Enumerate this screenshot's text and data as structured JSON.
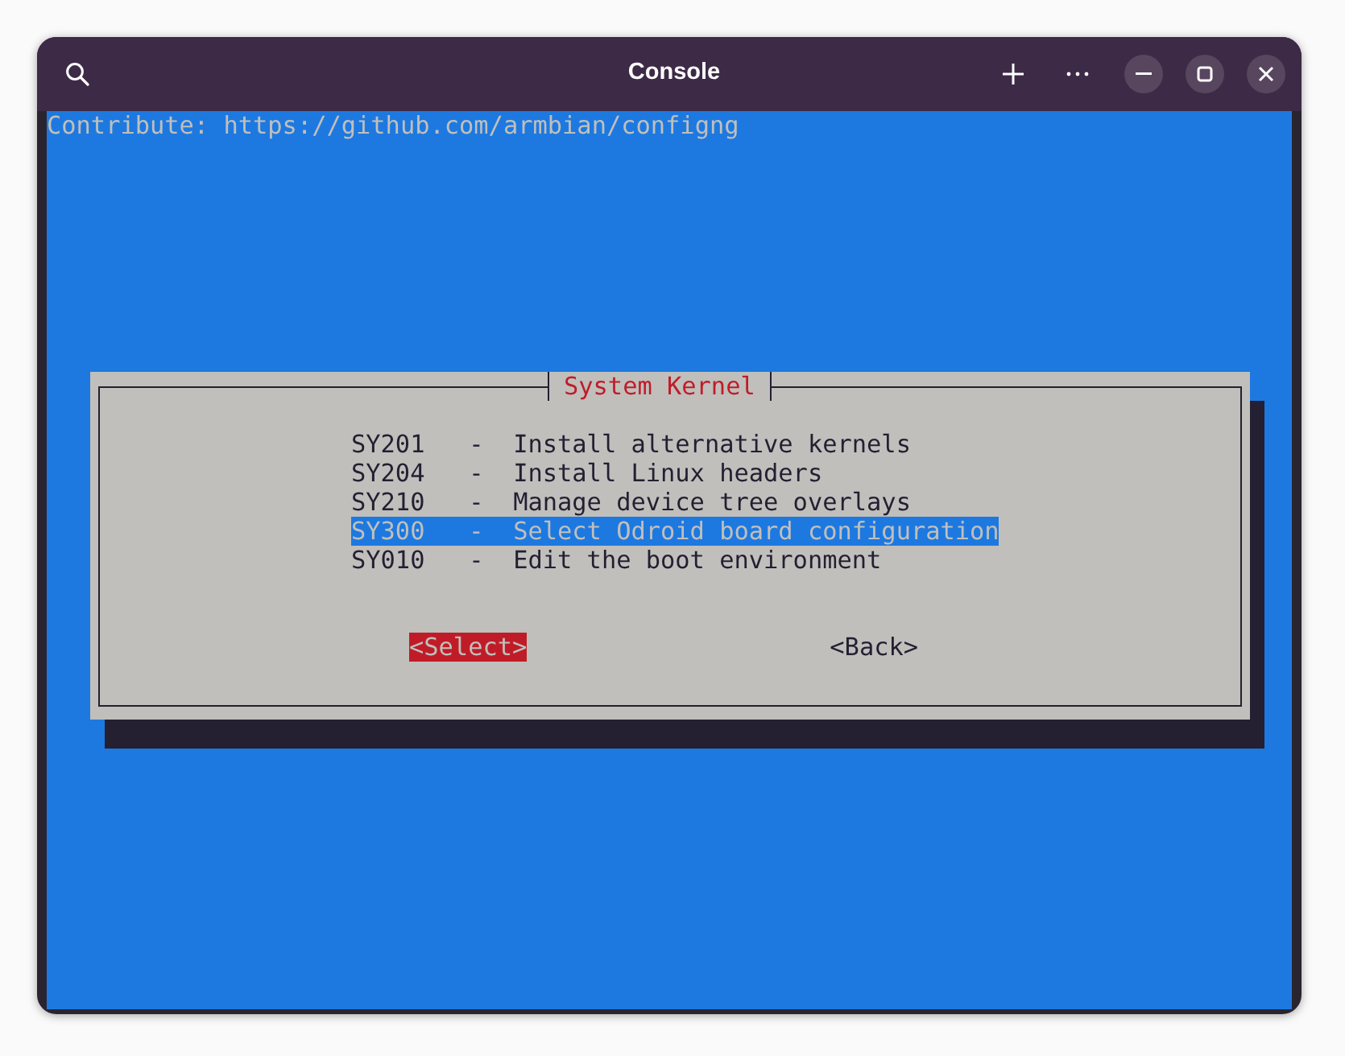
{
  "window": {
    "title": "Console"
  },
  "terminal": {
    "lines": [
      "Contribute: https://github.com/armbian/configng"
    ]
  },
  "dialog": {
    "title": "System Kernel",
    "items": [
      {
        "tag": "SY201",
        "separator": "-",
        "label": "Install alternative kernels",
        "selected": false
      },
      {
        "tag": "SY204",
        "separator": "-",
        "label": "Install Linux headers",
        "selected": false
      },
      {
        "tag": "SY210",
        "separator": "-",
        "label": "Manage device tree overlays",
        "selected": false
      },
      {
        "tag": "SY300",
        "separator": "-",
        "label": "Select Odroid board configuration",
        "selected": true
      },
      {
        "tag": "SY010",
        "separator": "-",
        "label": "Edit the boot environment",
        "selected": false
      }
    ],
    "buttons": [
      {
        "label": "<Select>",
        "selected": true
      },
      {
        "label": "<Back>",
        "selected": false
      }
    ]
  }
}
